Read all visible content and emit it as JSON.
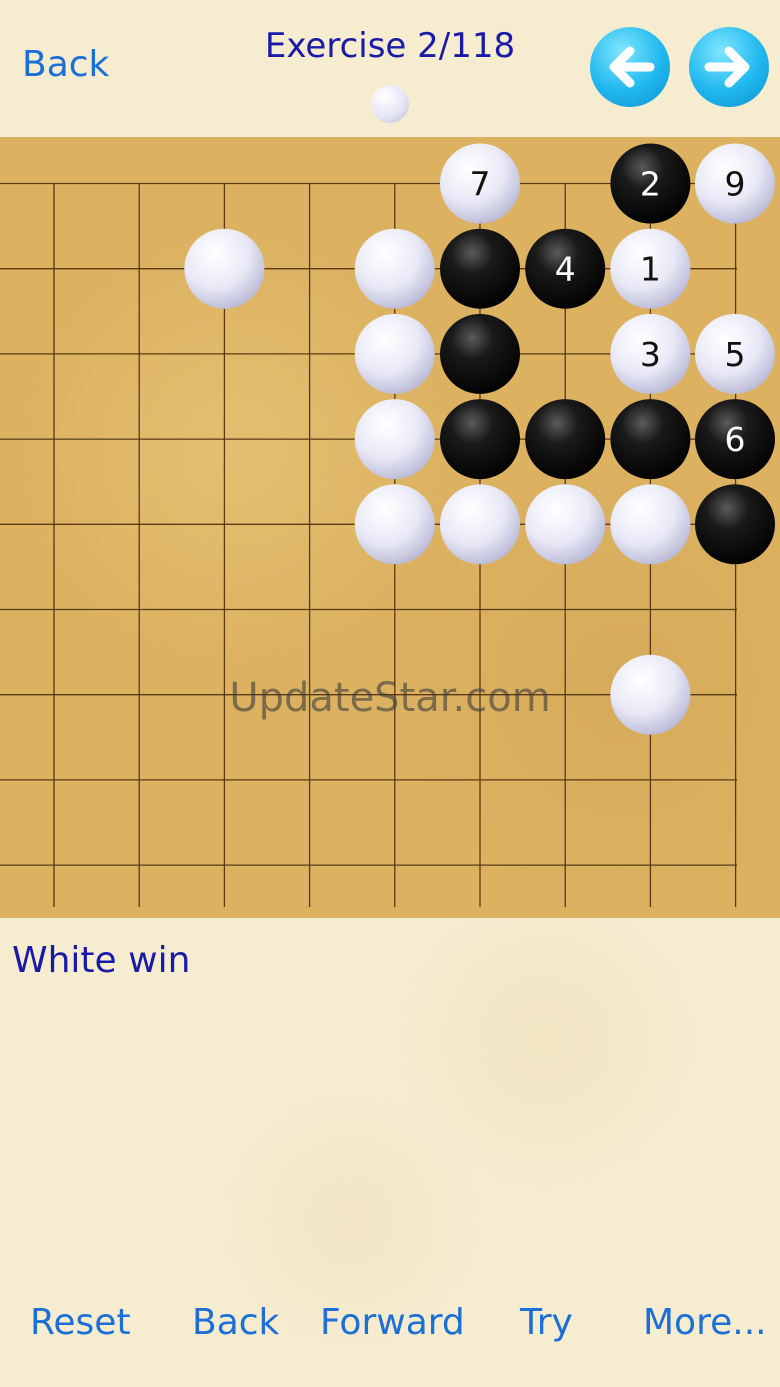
{
  "header": {
    "back_label": "Back",
    "title": "Exercise 2/118",
    "turn_indicator": "white",
    "prev_icon": "arrow-left-icon",
    "next_icon": "arrow-right-icon"
  },
  "board": {
    "grid_columns": 10,
    "grid_rows": 9,
    "colors": {
      "board": "#dcb261",
      "line": "#5a3a14"
    },
    "stones": [
      {
        "col": 2,
        "row": 1,
        "color": "white",
        "label": ""
      },
      {
        "col": 4,
        "row": 1,
        "color": "white",
        "label": ""
      },
      {
        "col": 4,
        "row": 2,
        "color": "white",
        "label": ""
      },
      {
        "col": 4,
        "row": 3,
        "color": "white",
        "label": ""
      },
      {
        "col": 4,
        "row": 4,
        "color": "white",
        "label": ""
      },
      {
        "col": 5,
        "row": 4,
        "color": "white",
        "label": ""
      },
      {
        "col": 6,
        "row": 4,
        "color": "white",
        "label": ""
      },
      {
        "col": 7,
        "row": 4,
        "color": "white",
        "label": ""
      },
      {
        "col": 7,
        "row": 6,
        "color": "white",
        "label": ""
      },
      {
        "col": 5,
        "row": 1,
        "color": "black",
        "label": ""
      },
      {
        "col": 5,
        "row": 2,
        "color": "black",
        "label": ""
      },
      {
        "col": 5,
        "row": 3,
        "color": "black",
        "label": ""
      },
      {
        "col": 6,
        "row": 3,
        "color": "black",
        "label": ""
      },
      {
        "col": 7,
        "row": 3,
        "color": "black",
        "label": ""
      },
      {
        "col": 8,
        "row": 4,
        "color": "black",
        "label": ""
      },
      {
        "col": 7,
        "row": 1,
        "color": "white",
        "label": "1"
      },
      {
        "col": 7,
        "row": 0,
        "color": "black",
        "label": "2"
      },
      {
        "col": 7,
        "row": 2,
        "color": "white",
        "label": "3"
      },
      {
        "col": 6,
        "row": 1,
        "color": "black",
        "label": "4"
      },
      {
        "col": 8,
        "row": 2,
        "color": "white",
        "label": "5"
      },
      {
        "col": 8,
        "row": 3,
        "color": "black",
        "label": "6"
      },
      {
        "col": 5,
        "row": 0,
        "color": "white",
        "label": "7"
      },
      {
        "col": 8,
        "row": 0,
        "color": "white",
        "label": "9"
      }
    ]
  },
  "watermark": "UpdateStar.com",
  "comment": "White win",
  "toolbar": {
    "reset": "Reset",
    "back": "Back",
    "forward": "Forward",
    "try": "Try",
    "more": "More..."
  }
}
